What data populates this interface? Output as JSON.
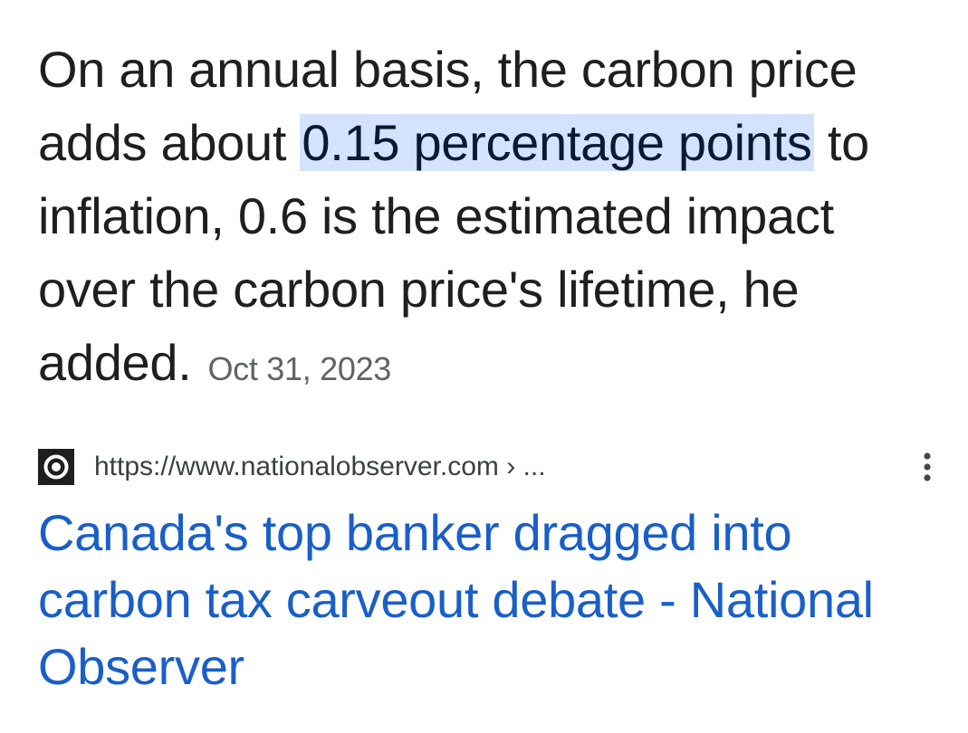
{
  "snippet": {
    "text_before": "On an annual basis, the carbon price adds about ",
    "highlight": "0.15 percentage points",
    "text_after": " to inflation, 0.6 is the estimated impact over the carbon price's lifetime, he added.",
    "date": "Oct 31, 2023"
  },
  "result": {
    "favicon_icon": "national-observer-logo-icon",
    "url": "https://www.nationalobserver.com › ...",
    "more_icon": "more-vert-icon",
    "title": "Canada's top banker dragged into carbon tax carveout debate - National Observer"
  },
  "colors": {
    "highlight_bg": "#d3e3fd",
    "link": "#1a5fc8",
    "body_text": "#1f1f1f",
    "secondary_text": "#5f6368"
  }
}
